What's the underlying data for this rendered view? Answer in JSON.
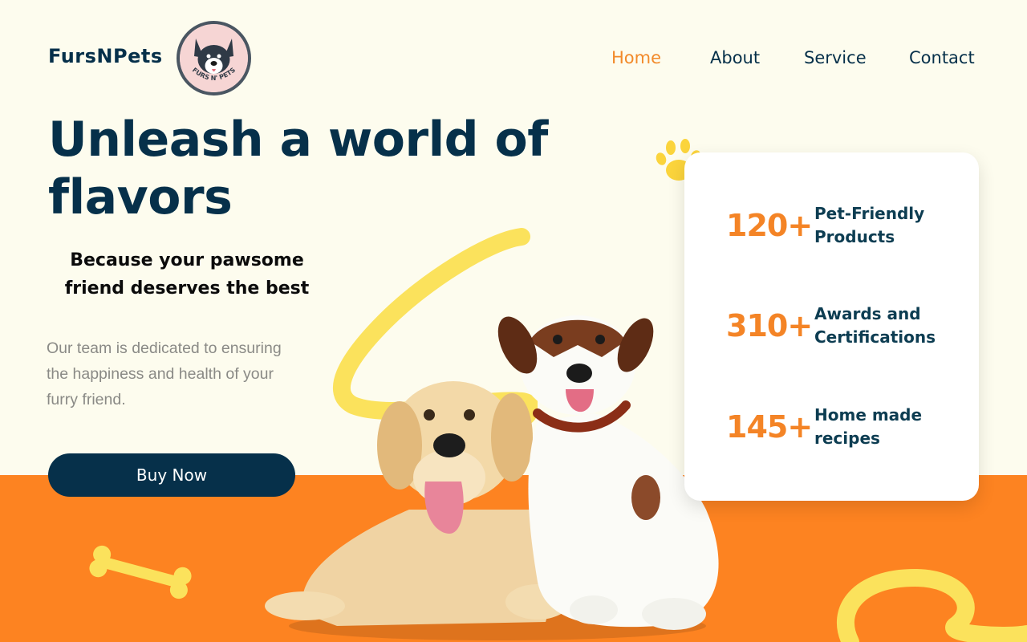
{
  "brand": {
    "name": "FursNPets",
    "logo_text": "FURS N' PETS"
  },
  "nav": {
    "home": "Home",
    "about": "About",
    "service": "Service",
    "contact": "Contact"
  },
  "hero": {
    "title": "Unleash a world of flavors",
    "tagline": "Because your pawsome friend deserves the best",
    "description": "Our team is dedicated to ensuring the happiness and health of your furry friend.",
    "cta": "Buy Now"
  },
  "stats": [
    {
      "number": "120+",
      "label": "Pet-Friendly Products"
    },
    {
      "number": "310+",
      "label": "Awards and Certifications"
    },
    {
      "number": "145+",
      "label": "Home made recipes"
    }
  ],
  "colors": {
    "navy": "#06304a",
    "orange": "#fd8321",
    "yellow": "#fbe25c",
    "cream": "#fdfcee"
  },
  "icons": [
    "paw-icon",
    "bone-icon",
    "dog-logo-icon"
  ]
}
